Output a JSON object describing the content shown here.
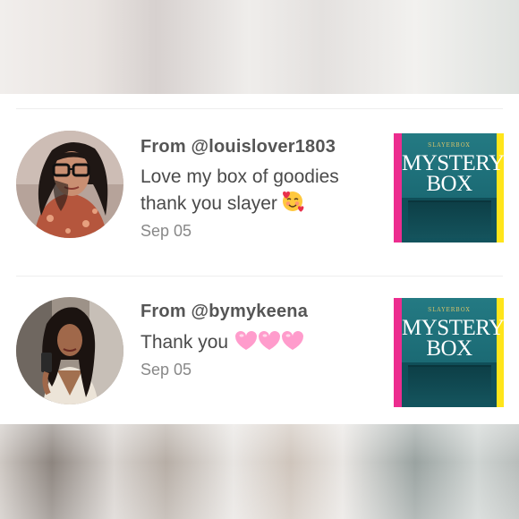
{
  "feed": {
    "items": [
      {
        "sender": "From @louislover1803",
        "message_line1": "Love my box of goodies",
        "message_line2": "thank you slayer",
        "emoji": "smiling-face-with-hearts",
        "date": "Sep 05",
        "thumbnail": {
          "brand": "SLAYERBOX",
          "title": "MYSTERY\nBOX"
        }
      },
      {
        "sender": "From @bymykeena",
        "message_line1": "Thank you",
        "emoji": "pink-hearts",
        "date": "Sep 05",
        "thumbnail": {
          "brand": "SLAYERBOX",
          "title": "MYSTERY\nBOX"
        }
      }
    ]
  },
  "colors": {
    "accent_pink": "#ec2d8f",
    "accent_yellow": "#ffe51a",
    "box_teal": "#1d6f79",
    "heart_pink": "#ff8fc4"
  }
}
